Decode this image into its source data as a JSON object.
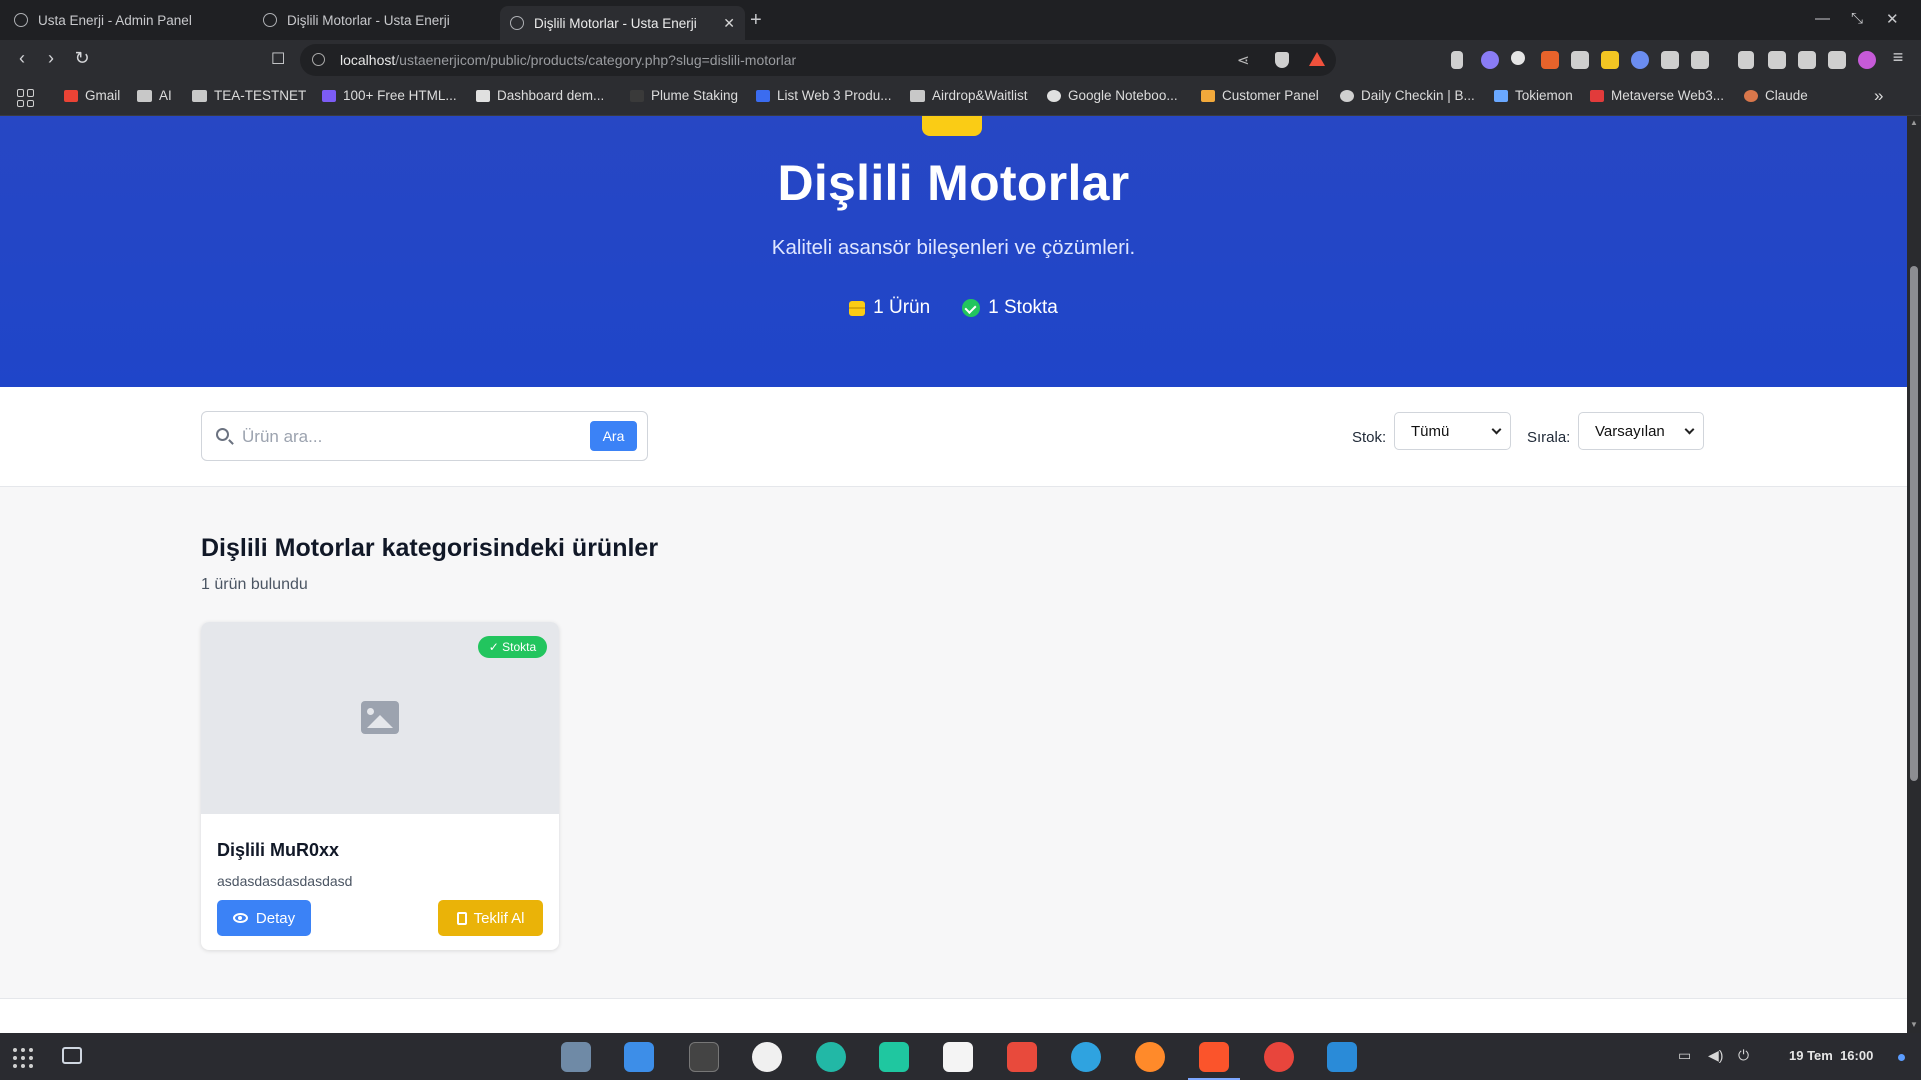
{
  "browser": {
    "tabs": [
      {
        "title": "Usta Enerji - Admin Panel"
      },
      {
        "title": "Dişlili Motorlar - Usta Enerji"
      },
      {
        "title": "Dişlili Motorlar - Usta Enerji"
      }
    ],
    "url_host": "localhost",
    "url_path": "/ustaenerjicom/public/products/category.php?slug=dislili-motorlar",
    "bookmarks": [
      "Gmail",
      "AI",
      "TEA-TESTNET",
      "100+ Free HTML...",
      "Dashboard dem...",
      "Plume Staking",
      "List Web 3 Produ...",
      "Airdrop&Waitlist",
      "Google Noteboo...",
      "Customer Panel",
      "Daily Checkin | B...",
      "Tokiemon",
      "Metaverse Web3...",
      "Claude"
    ]
  },
  "hero": {
    "title": "Dişlili Motorlar",
    "subtitle": "Kaliteli asansör bileşenleri ve çözümleri.",
    "stat_products": "1 Ürün",
    "stat_stock": "1 Stokta"
  },
  "filters": {
    "search_placeholder": "Ürün ara...",
    "search_button": "Ara",
    "stock_label": "Stok:",
    "stock_value": "Tümü",
    "sort_label": "Sırala:",
    "sort_value": "Varsayılan"
  },
  "content": {
    "title": "Dişlili Motorlar kategorisindeki ürünler",
    "count": "1 ürün bulundu"
  },
  "products": [
    {
      "name": "Dişlili MuR0xx",
      "description": "asdasdasdasdasdasd",
      "badge": "✓ Stokta",
      "detail_button": "Detay",
      "quote_button": "Teklif Al"
    }
  ],
  "taskbar": {
    "date": "19 Tem",
    "time": "16:00"
  },
  "colors": {
    "hero": "#1f45c9",
    "primary": "#3b82f6",
    "success": "#22c55e",
    "warning": "#eab308"
  }
}
